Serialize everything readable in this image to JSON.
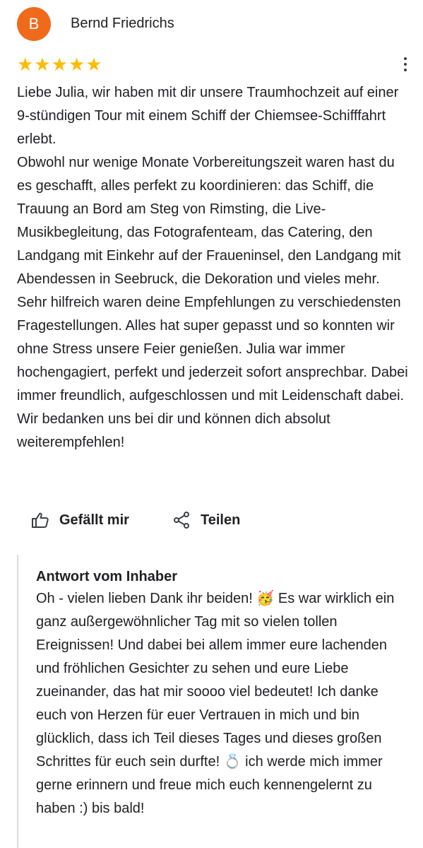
{
  "reviewer": {
    "avatar_letter": "B",
    "avatar_color": "#f06a1c",
    "name": "Bernd Friedrichs"
  },
  "rating": {
    "value": 5,
    "max": 5,
    "star_color": "#fbbc04"
  },
  "menu": {
    "icon": "more-vert-icon"
  },
  "review": {
    "text": "Liebe Julia, wir haben mit dir unsere Traumhochzeit auf einer 9-stündigen Tour mit einem Schiff der Chiemsee-Schifffahrt erlebt.\nObwohl nur wenige Monate Vorbereitungszeit waren hast du es geschafft, alles perfekt zu koordinieren: das Schiff, die Trauung an Bord am Steg von Rimsting, die Live-Musikbegleitung, das Fotografenteam, das Catering, den Landgang mit Einkehr auf der Fraueninsel, den Landgang mit Abendessen in Seebruck, die Dekoration und vieles mehr. Sehr hilfreich waren deine Empfehlungen zu verschiedensten Fragestellungen. Alles hat super gepasst und so konnten wir ohne Stress unsere Feier genießen. Julia war immer hochengagiert, perfekt und jederzeit sofort ansprechbar. Dabei immer freundlich, aufgeschlossen und mit Leidenschaft dabei. Wir bedanken uns bei dir und können dich absolut weiterempfehlen!"
  },
  "actions": {
    "like_label": "Gefällt mir",
    "like_icon": "thumbs-up-icon",
    "share_label": "Teilen",
    "share_icon": "share-icon"
  },
  "owner_reply": {
    "heading": "Antwort vom Inhaber",
    "text": "Oh - vielen lieben Dank ihr beiden! 🥳 Es war wirklich ein ganz außergewöhnlicher Tag mit so vielen tollen Ereignissen! Und dabei bei allem immer eure lachenden und fröhlichen Gesichter zu sehen und eure Liebe zueinander, das hat mir soooo viel bedeutet! Ich danke euch von Herzen für euer Vertrauen in mich und bin glücklich, dass ich Teil dieses Tages und dieses großen Schrittes für euch sein durfte! 💍 ich werde mich immer gerne erinnern und freue mich euch kennengelernt zu haben :) bis bald!"
  }
}
